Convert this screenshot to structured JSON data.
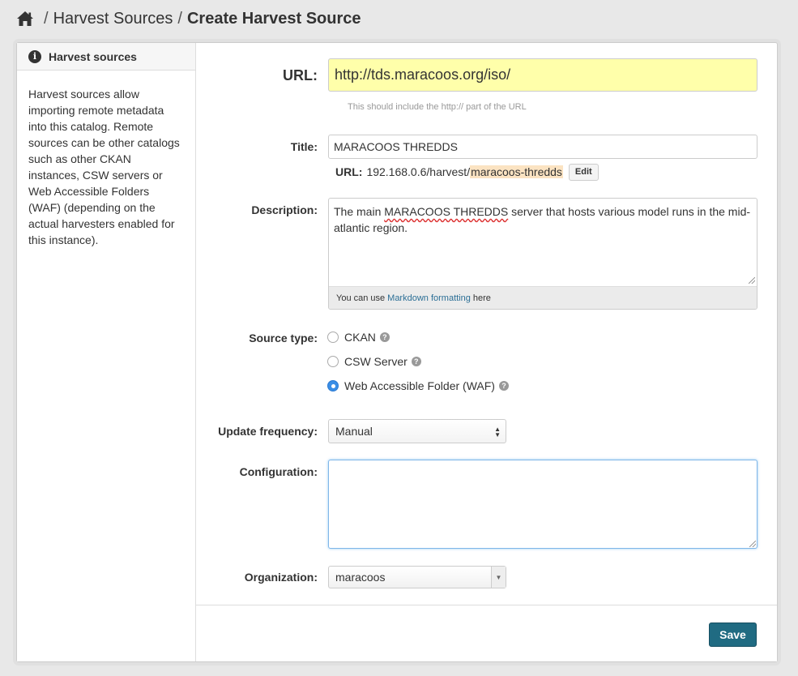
{
  "breadcrumb": {
    "home_icon": "home-icon",
    "separator": "/",
    "parent": "Harvest Sources",
    "current": "Create Harvest Source"
  },
  "sidebar": {
    "icon": "info-icon",
    "heading": "Harvest sources",
    "body": "Harvest sources allow importing remote metadata into this catalog. Remote sources can be other catalogs such as other CKAN instances, CSW servers or Web Accessible Folders (WAF) (depending on the actual harvesters enabled for this instance)."
  },
  "form": {
    "url": {
      "label": "URL:",
      "value": "http://tds.maracoos.org/iso/",
      "help": "This should include the http:// part of the URL"
    },
    "title": {
      "label": "Title:",
      "value": "MARACOOS THREDDS",
      "slug_label": "URL:",
      "slug_prefix": "192.168.0.6/harvest/",
      "slug_value": "maracoos-thredds",
      "edit_label": "Edit"
    },
    "description": {
      "label": "Description:",
      "text_before": "The main ",
      "text_spell": "MARACOOS THREDDS",
      "text_after": " server that hosts various model runs in the mid-atlantic region.",
      "foot_before": "You can use",
      "foot_link": "Markdown formatting",
      "foot_after": "here"
    },
    "source_type": {
      "label": "Source type:",
      "options": [
        {
          "label": "CKAN",
          "checked": false
        },
        {
          "label": "CSW Server",
          "checked": false
        },
        {
          "label": "Web Accessible Folder (WAF)",
          "checked": true
        }
      ],
      "help_icon": "question-circle-icon"
    },
    "update_frequency": {
      "label": "Update frequency:",
      "value": "Manual"
    },
    "configuration": {
      "label": "Configuration:",
      "value": ""
    },
    "organization": {
      "label": "Organization:",
      "value": "maracoos"
    },
    "save_label": "Save"
  },
  "colors": {
    "url_bg": "#ffffaa",
    "save_bg": "#206b82",
    "link": "#2c6f96",
    "radio_checked": "#3a8ee6"
  }
}
